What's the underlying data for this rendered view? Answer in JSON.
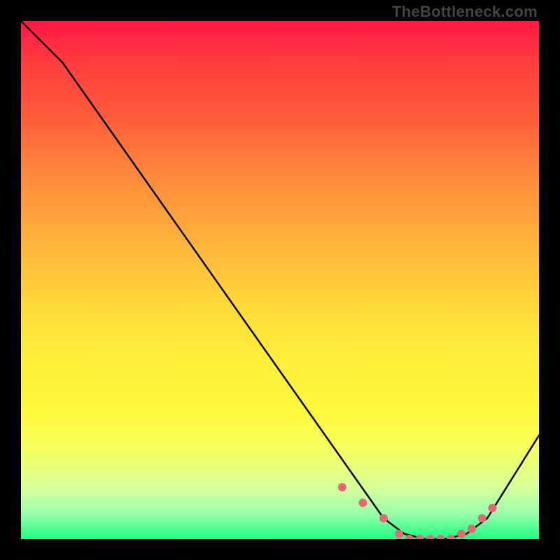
{
  "watermark": "TheBottleneck.com",
  "chart_data": {
    "type": "line",
    "title": "",
    "xlabel": "",
    "ylabel": "",
    "xlim": [
      0,
      100
    ],
    "ylim": [
      0,
      100
    ],
    "grid": false,
    "legend": false,
    "series": [
      {
        "name": "bottleneck-curve",
        "x": [
          0,
          8,
          70,
          74,
          78,
          82,
          86,
          90,
          100
        ],
        "values": [
          100,
          92,
          4,
          1,
          0,
          0,
          1,
          4,
          20
        ]
      }
    ],
    "markers": {
      "name": "highlighted-points",
      "x": [
        62,
        66,
        70,
        73,
        75,
        77,
        79,
        81,
        83,
        85,
        87,
        89,
        91
      ],
      "values": [
        10,
        7,
        4,
        1,
        0,
        0,
        0,
        0,
        0,
        1,
        2,
        4,
        6
      ]
    }
  }
}
